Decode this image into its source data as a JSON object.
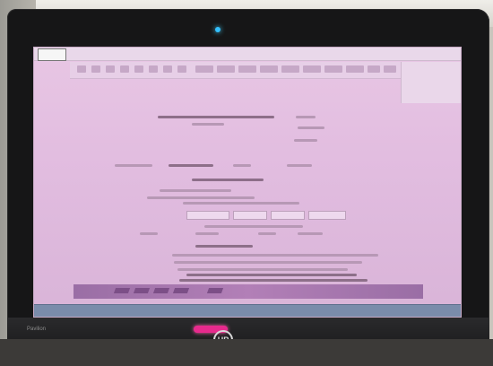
{
  "scene": {
    "brand_label": "HP",
    "bezel_text": "Pavilion",
    "app_logo_label": "",
    "window_controls": "",
    "toolbar_buttons": [
      "",
      "",
      "",
      "",
      "",
      "",
      "",
      "",
      "",
      "",
      "",
      "",
      "",
      "",
      "",
      "",
      "",
      ""
    ],
    "side_panel_items": [
      "",
      "",
      ""
    ],
    "taskbar_tray": ""
  },
  "colors": {
    "screen_tint": "#e2bde0",
    "status_strip": "#9a6ea5",
    "taskbar": "#7a8cab",
    "power_button": "#e72a8d"
  }
}
